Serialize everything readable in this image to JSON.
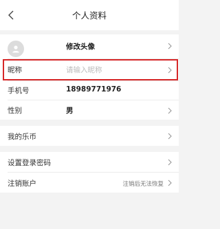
{
  "header": {
    "title": "个人资料",
    "back_icon": "chevron-left-icon"
  },
  "profile": {
    "avatar_label": "修改头像",
    "nickname_label": "昵称",
    "nickname_placeholder": "请输入昵称",
    "phone_label": "手机号",
    "phone_value": "18989771976",
    "gender_label": "性别",
    "gender_value": "男"
  },
  "coins": {
    "label": "我的乐币"
  },
  "account": {
    "password_label": "设置登录密码",
    "cancel_label": "注销账户",
    "cancel_hint": "注销后无法恢复"
  },
  "colors": {
    "highlight": "#d62728",
    "background": "#f3f3f3",
    "placeholder": "#bdbdbd"
  }
}
